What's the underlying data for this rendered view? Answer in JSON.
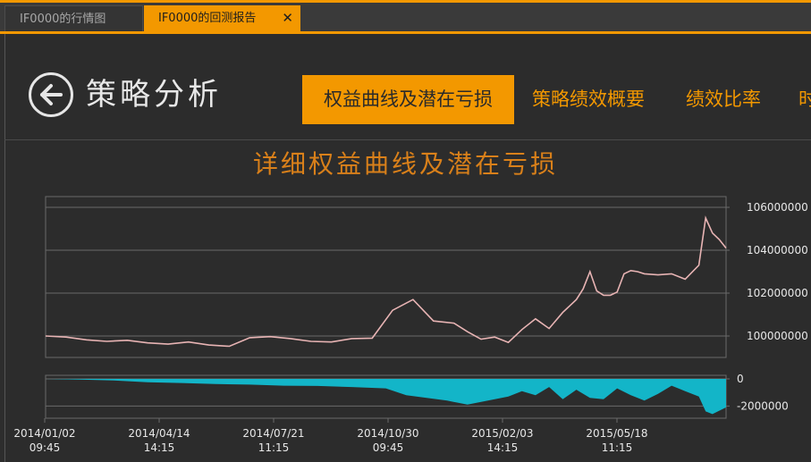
{
  "tabs": [
    {
      "label": "IF0000的行情图",
      "active": false
    },
    {
      "label": "IF0000的回测报告",
      "active": true
    }
  ],
  "close_glyph": "✕",
  "page_title": "策略分析",
  "nav_tabs": [
    "权益曲线及潜在亏损",
    "策略绩效概要",
    "绩效比率",
    "时"
  ],
  "chart_title": "详细权益曲线及潜在亏损",
  "colors": {
    "accent": "#f39800",
    "equity_line": "#e8b4b4",
    "drawdown_fill": "#13b5c8",
    "grid": "#6a6a6a",
    "title": "#d9801a"
  },
  "chart_data": [
    {
      "type": "line",
      "title": "",
      "series": [
        {
          "x": [
            0,
            3,
            6,
            9,
            12,
            15,
            18,
            21,
            24,
            27,
            30,
            33,
            36,
            39,
            42,
            45,
            48,
            51,
            54,
            57,
            60,
            62,
            64,
            66,
            68,
            70,
            72,
            74,
            76,
            78,
            79,
            80,
            81,
            82,
            83,
            84,
            85,
            86,
            87,
            88,
            90,
            92,
            94,
            96,
            97,
            98,
            99,
            100
          ],
          "values": [
            100000000,
            99950000,
            99820000,
            99750000,
            99800000,
            99680000,
            99620000,
            99720000,
            99580000,
            99520000,
            99920000,
            99970000,
            99880000,
            99750000,
            99720000,
            99880000,
            99900000,
            101200000,
            101700000,
            100700000,
            100600000,
            100200000,
            99850000,
            99950000,
            99700000,
            100300000,
            100800000,
            100350000,
            101100000,
            101700000,
            102200000,
            103000000,
            102100000,
            101900000,
            101900000,
            102050000,
            102900000,
            103050000,
            103000000,
            102900000,
            102850000,
            102900000,
            102650000,
            103300000,
            105500000,
            104800000,
            104500000,
            104100000
          ]
        }
      ],
      "y_ticks": [
        "106000000",
        "104000000",
        "102000000",
        "100000000"
      ],
      "ylim": [
        99000000,
        106500000
      ],
      "grid": true
    },
    {
      "type": "area",
      "title": "",
      "series": [
        {
          "x": [
            0,
            5,
            10,
            15,
            20,
            25,
            30,
            35,
            40,
            45,
            50,
            53,
            56,
            59,
            62,
            65,
            68,
            70,
            72,
            74,
            76,
            78,
            80,
            82,
            84,
            86,
            88,
            90,
            92,
            94,
            96,
            97,
            98,
            100
          ],
          "values": [
            0,
            -50000,
            -120000,
            -250000,
            -300000,
            -380000,
            -420000,
            -500000,
            -520000,
            -600000,
            -700000,
            -1200000,
            -1400000,
            -1600000,
            -1900000,
            -1600000,
            -1300000,
            -900000,
            -1200000,
            -600000,
            -1500000,
            -800000,
            -1400000,
            -1500000,
            -700000,
            -1200000,
            -1600000,
            -1100000,
            -500000,
            -900000,
            -1300000,
            -2400000,
            -2600000,
            -2100000
          ]
        }
      ],
      "y_ticks": [
        "0",
        "-2000000"
      ],
      "ylim": [
        -2900000,
        0
      ],
      "grid": true
    }
  ],
  "x_ticks": [
    {
      "date": "2014/01/02",
      "time": "09:45"
    },
    {
      "date": "2014/04/14",
      "time": "14:15"
    },
    {
      "date": "2014/07/21",
      "time": "11:15"
    },
    {
      "date": "2014/10/30",
      "time": "09:45"
    },
    {
      "date": "2015/02/03",
      "time": "14:15"
    },
    {
      "date": "2015/05/18",
      "time": "11:15"
    }
  ]
}
